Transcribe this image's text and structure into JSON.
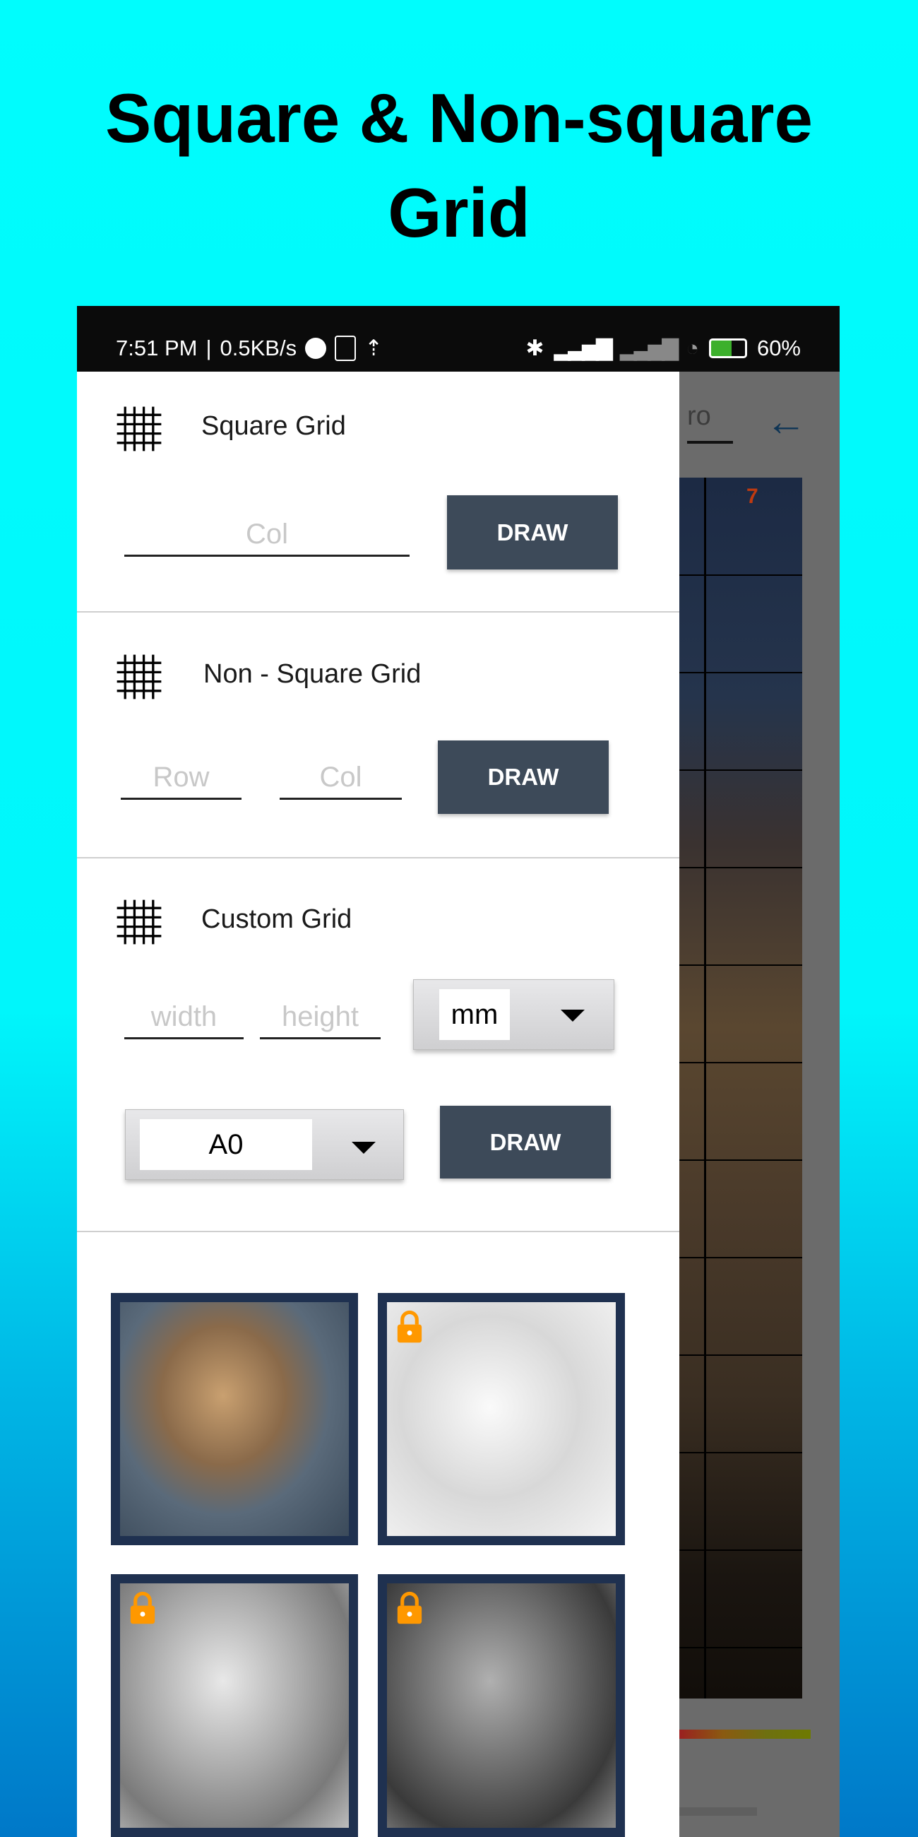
{
  "headline": {
    "line1": "Square & Non-square",
    "line2": "Grid"
  },
  "status_bar": {
    "time": "7:51 PM",
    "speed": "0.5KB/s",
    "battery": "60%",
    "icons": [
      "app-notification-icon",
      "gridart-app-icon",
      "upload-icon",
      "bluetooth-icon",
      "signal-icon",
      "signal-icon",
      "wifi-icon",
      "battery-charging-icon"
    ]
  },
  "background_app": {
    "row_input_value": "ro",
    "back_icon": "arrow-left-icon",
    "grid_number": "7"
  },
  "drawer": {
    "square": {
      "title": "Square Grid",
      "col_placeholder": "Col",
      "draw_label": "DRAW"
    },
    "non_square": {
      "title": "Non - Square Grid",
      "row_placeholder": "Row",
      "col_placeholder": "Col",
      "draw_label": "DRAW"
    },
    "custom": {
      "title": "Custom Grid",
      "width_placeholder": "width",
      "height_placeholder": "height",
      "unit_selected": "mm",
      "paper_selected": "A0",
      "draw_label": "DRAW"
    },
    "filters": [
      {
        "name": "original",
        "locked": false
      },
      {
        "name": "sketch",
        "locked": true
      },
      {
        "name": "light-gray",
        "locked": true
      },
      {
        "name": "grayscale",
        "locked": true
      }
    ]
  },
  "colors": {
    "button": "#3d4a59",
    "thumb_frame": "#1f3150",
    "lock": "#ff9800",
    "bg_top": "#00fdfd",
    "bg_bottom": "#0078c8"
  }
}
